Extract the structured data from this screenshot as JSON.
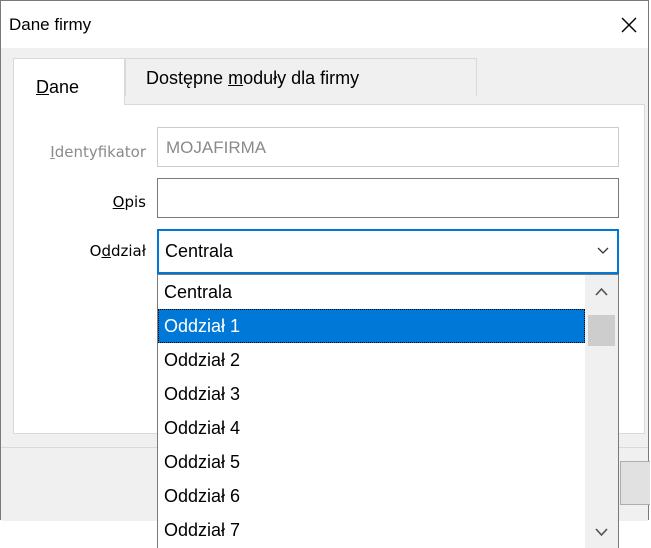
{
  "window": {
    "title": "Dane firmy"
  },
  "tabs": [
    {
      "label_pre": "",
      "label_u": "D",
      "label_post": "ane"
    },
    {
      "label_pre": "Dostępne ",
      "label_u": "m",
      "label_post": "oduły dla firmy"
    }
  ],
  "form": {
    "identyfikator": {
      "label_pre": "",
      "label_u": "I",
      "label_post": "dentyfikator",
      "value": "MOJAFIRMA"
    },
    "opis": {
      "label_pre": "",
      "label_u": "O",
      "label_post": "pis",
      "value": ""
    },
    "oddzial": {
      "label_pre": "O",
      "label_u": "d",
      "label_post": "dział",
      "value": "Centrala"
    }
  },
  "dropdown": {
    "items": [
      "Centrala",
      "Oddział 1",
      "Oddział 2",
      "Oddział 3",
      "Oddział 4",
      "Oddział 5",
      "Oddział 6",
      "Oddział 7"
    ],
    "selected": "Oddział 1"
  },
  "colors": {
    "accent": "#0078d7",
    "window_bg": "#f0f0f0",
    "disabled_text": "#8a8a8a"
  }
}
